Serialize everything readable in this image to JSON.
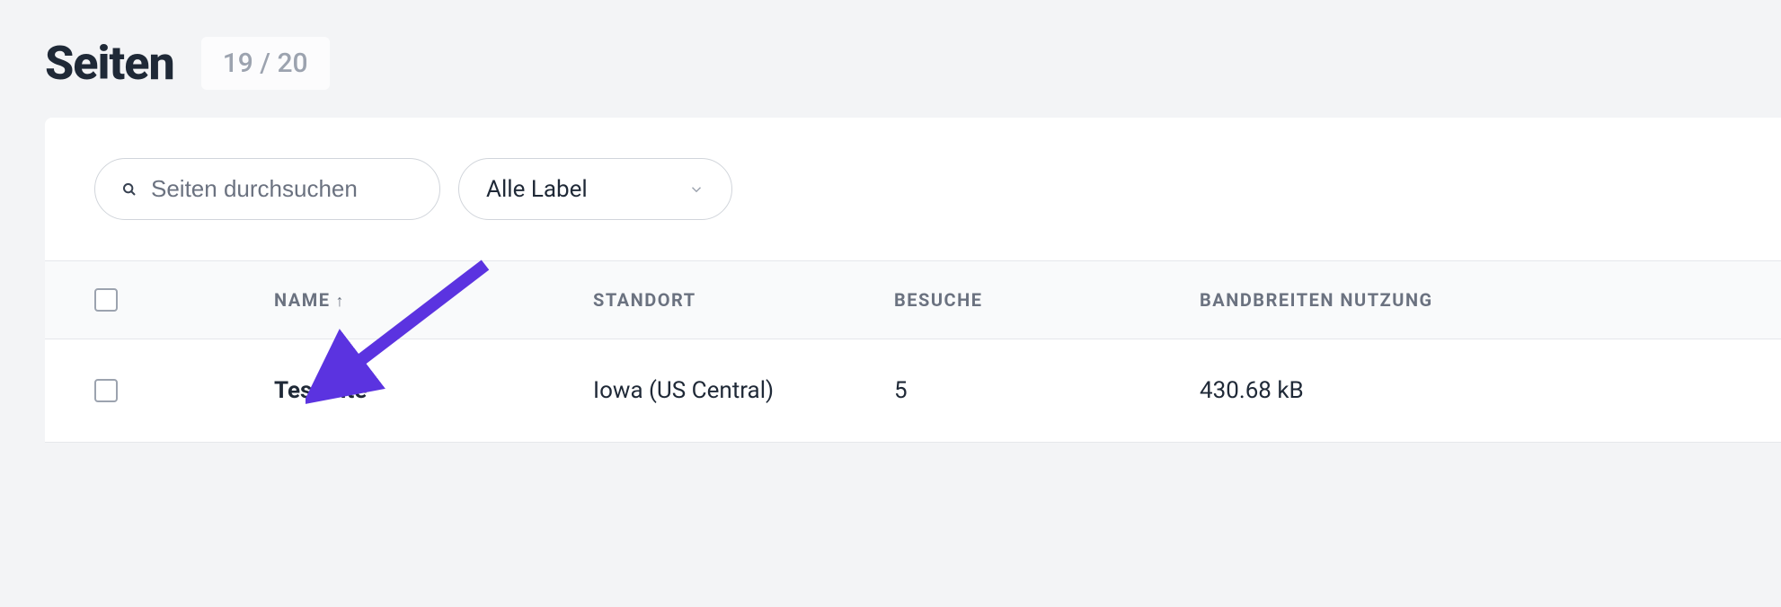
{
  "header": {
    "title": "Seiten",
    "count_badge": "19 / 20"
  },
  "controls": {
    "search_placeholder": "Seiten durchsuchen",
    "label_select_text": "Alle Label"
  },
  "table": {
    "columns": {
      "name": "NAME",
      "location": "STANDORT",
      "visits": "BESUCHE",
      "bandwidth": "BANDBREITEN NUTZUNG"
    },
    "sort_indicator": "↑",
    "rows": [
      {
        "name": "Test Site",
        "location": "Iowa (US Central)",
        "visits": "5",
        "bandwidth": "430.68 kB"
      }
    ]
  },
  "annotation": {
    "arrow_color": "#5b33e0"
  }
}
